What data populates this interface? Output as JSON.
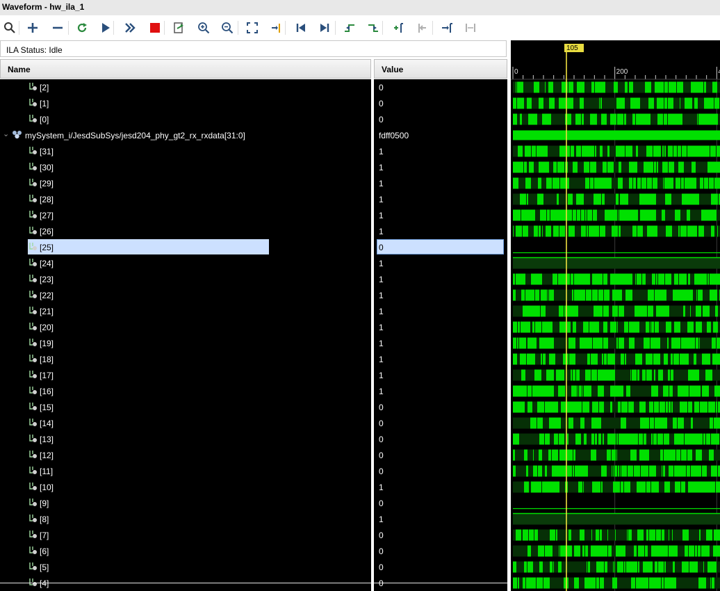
{
  "window": {
    "title": "Waveform - hw_ila_1"
  },
  "toolbar": {
    "icons": [
      "search-icon",
      "plus-icon",
      "minus-icon",
      "refresh-icon",
      "play-icon",
      "fast-forward-icon",
      "stop-icon",
      "export-icon",
      "zoom-in-icon",
      "zoom-out-icon",
      "zoom-fit-icon",
      "cursor-icon",
      "go-first-icon",
      "go-last-icon",
      "prev-transition-icon",
      "next-transition-icon",
      "add-marker-icon",
      "prev-marker-icon",
      "next-marker-icon",
      "swap-cursor-icon"
    ]
  },
  "status": {
    "text": "ILA Status: Idle"
  },
  "headers": {
    "name": "Name",
    "value": "Value"
  },
  "timeline": {
    "cursor_label": "105",
    "tick_0": "0",
    "tick_200": "200",
    "tick_400": "4",
    "cursor_value": 105
  },
  "colors": {
    "wave": "#00e000",
    "cursor": "#f0e040",
    "selection": "#cce0ff"
  },
  "rows": [
    {
      "name": "[2]",
      "value": "0",
      "kind": "bit",
      "wave": "busy"
    },
    {
      "name": "[1]",
      "value": "0",
      "kind": "bit",
      "wave": "busy"
    },
    {
      "name": "[0]",
      "value": "0",
      "kind": "bit",
      "wave": "busy"
    },
    {
      "name": "mySystem_i/JesdSubSys/jesd204_phy_gt2_rx_rxdata[31:0]",
      "value": "fdff0500",
      "kind": "bus",
      "wave": "bus"
    },
    {
      "name": "[31]",
      "value": "1",
      "kind": "bit",
      "wave": "busy"
    },
    {
      "name": "[30]",
      "value": "1",
      "kind": "bit",
      "wave": "busy"
    },
    {
      "name": "[29]",
      "value": "1",
      "kind": "bit",
      "wave": "busy"
    },
    {
      "name": "[28]",
      "value": "1",
      "kind": "bit",
      "wave": "busy"
    },
    {
      "name": "[27]",
      "value": "1",
      "kind": "bit",
      "wave": "busy"
    },
    {
      "name": "[26]",
      "value": "1",
      "kind": "bit",
      "wave": "busy"
    },
    {
      "name": "[25]",
      "value": "0",
      "kind": "bit",
      "wave": "low",
      "selected": true
    },
    {
      "name": "[24]",
      "value": "1",
      "kind": "bit",
      "wave": "high"
    },
    {
      "name": "[23]",
      "value": "1",
      "kind": "bit",
      "wave": "busy"
    },
    {
      "name": "[22]",
      "value": "1",
      "kind": "bit",
      "wave": "busy"
    },
    {
      "name": "[21]",
      "value": "1",
      "kind": "bit",
      "wave": "busy"
    },
    {
      "name": "[20]",
      "value": "1",
      "kind": "bit",
      "wave": "busy"
    },
    {
      "name": "[19]",
      "value": "1",
      "kind": "bit",
      "wave": "busy"
    },
    {
      "name": "[18]",
      "value": "1",
      "kind": "bit",
      "wave": "busy"
    },
    {
      "name": "[17]",
      "value": "1",
      "kind": "bit",
      "wave": "busy"
    },
    {
      "name": "[16]",
      "value": "1",
      "kind": "bit",
      "wave": "busy"
    },
    {
      "name": "[15]",
      "value": "0",
      "kind": "bit",
      "wave": "busy"
    },
    {
      "name": "[14]",
      "value": "0",
      "kind": "bit",
      "wave": "busy"
    },
    {
      "name": "[13]",
      "value": "0",
      "kind": "bit",
      "wave": "busy"
    },
    {
      "name": "[12]",
      "value": "0",
      "kind": "bit",
      "wave": "busy"
    },
    {
      "name": "[11]",
      "value": "0",
      "kind": "bit",
      "wave": "busy"
    },
    {
      "name": "[10]",
      "value": "1",
      "kind": "bit",
      "wave": "busy"
    },
    {
      "name": "[9]",
      "value": "0",
      "kind": "bit",
      "wave": "low"
    },
    {
      "name": "[8]",
      "value": "1",
      "kind": "bit",
      "wave": "high"
    },
    {
      "name": "[7]",
      "value": "0",
      "kind": "bit",
      "wave": "busy"
    },
    {
      "name": "[6]",
      "value": "0",
      "kind": "bit",
      "wave": "busy"
    },
    {
      "name": "[5]",
      "value": "0",
      "kind": "bit",
      "wave": "busy"
    },
    {
      "name": "[4]",
      "value": "0",
      "kind": "bit",
      "wave": "busy"
    }
  ]
}
